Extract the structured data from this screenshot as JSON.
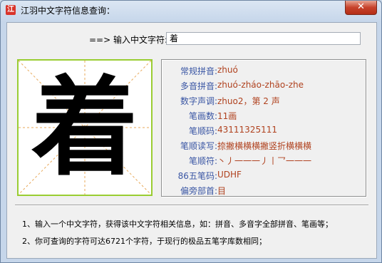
{
  "window": {
    "title": "江羽中文字符信息查询：",
    "app_icon_glyph": "江",
    "close_glyph": "✕"
  },
  "input": {
    "label": "==> 输入中文字符:",
    "value": "着"
  },
  "display": {
    "character": "着",
    "grid_color": "#9acd32"
  },
  "info": [
    {
      "label": "常规拼音:",
      "value": "zhuó"
    },
    {
      "label": "多音拼音:",
      "value": "zhuó-zháo-zhāo-zhe"
    },
    {
      "label": "数字声调:",
      "value": "zhuo2，第 2 声"
    },
    {
      "label": "笔画数:",
      "value": "11画"
    },
    {
      "label": "笔顺码:",
      "value": "43111325111"
    },
    {
      "label": "笔顺读写:",
      "value": "捺撇横横横撇竖折横横横"
    },
    {
      "label": "笔顺符:",
      "value": "丶丿一一一丿丨乛一一一"
    },
    {
      "label": "86五笔码:",
      "value": "UDHF"
    },
    {
      "label": "偏旁部首:",
      "value": "目"
    }
  ],
  "notes": [
    "1、输入一个中文字符，获得该中文字符相关信息，如：拼音、多音字全部拼音、笔画等；",
    "2、你可查询的字符可达6721个字符，于现行的极品五笔字库数相同；"
  ],
  "colors": {
    "label": "#3a56a4",
    "value": "#b0421f",
    "grid_border": "#9acd32"
  }
}
